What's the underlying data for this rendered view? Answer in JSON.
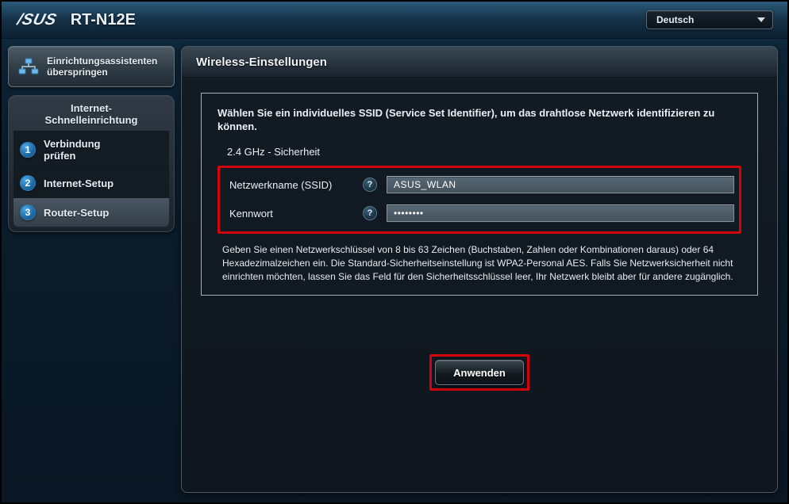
{
  "header": {
    "brand": "/SUS",
    "model": "RT-N12E",
    "language": "Deutsch"
  },
  "sidebar": {
    "skip_label": "Einrichtungsassistenten überspringen",
    "steps_title": "Internet-\nSchnelleinrichtung",
    "steps": [
      {
        "num": "1",
        "label": "Verbindung\nprüfen"
      },
      {
        "num": "2",
        "label": "Internet-Setup"
      },
      {
        "num": "3",
        "label": "Router-Setup"
      }
    ]
  },
  "main": {
    "title": "Wireless-Einstellungen",
    "instruction": "Wählen Sie ein individuelles SSID (Service Set Identifier), um das drahtlose Netzwerk identifizieren zu können.",
    "band_security_label": "2.4 GHz - Sicherheit",
    "ssid_label": "Netzwerkname (SSID)",
    "ssid_value": "ASUS_WLAN",
    "password_label": "Kennwort",
    "password_value": "••••••••",
    "hint": "Geben Sie einen Netzwerkschlüssel von 8 bis 63 Zeichen (Buchstaben, Zahlen oder Kombinationen daraus) oder 64 Hexadezimalzeichen ein. Die Standard-Sicherheitseinstellung ist WPA2-Personal AES. Falls Sie Netzwerksicherheit nicht einrichten möchten, lassen Sie das Feld für den Sicherheitsschlüssel leer, Ihr Netzwerk bleibt aber für andere zugänglich.",
    "apply_label": "Anwenden"
  }
}
